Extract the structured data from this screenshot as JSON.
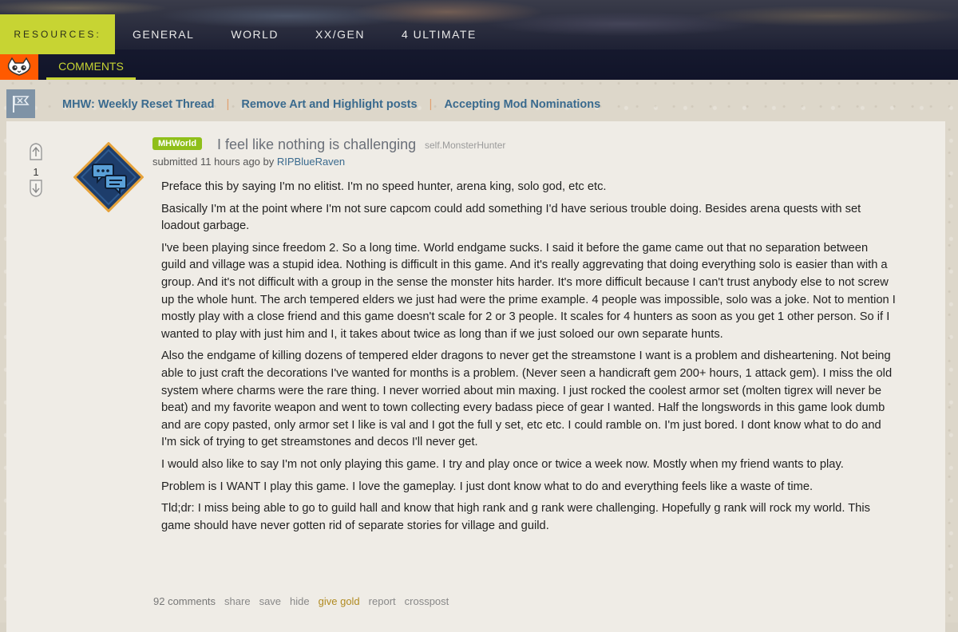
{
  "header": {
    "resources_label": "RESOURCES:",
    "nav": [
      "GENERAL",
      "WORLD",
      "XX/GEN",
      "4 ULTIMATE"
    ],
    "active_tab": "COMMENTS"
  },
  "sticky_links": [
    "MHW: Weekly Reset Thread",
    "Remove Art and Highlight posts",
    "Accepting Mod Nominations"
  ],
  "post": {
    "score": "1",
    "flair": "MHWorld",
    "title": "I feel like nothing is challenging",
    "domain": "self.MonsterHunter",
    "submitted_prefix": "submitted 11 hours ago by",
    "author": "RIPBlueRaven",
    "paragraphs": [
      "Preface this by saying I'm no elitist. I'm no speed hunter, arena king, solo god, etc etc.",
      "Basically I'm at the point where I'm not sure capcom could add something I'd have serious trouble doing. Besides arena quests with set loadout garbage.",
      "I've been playing since freedom 2. So a long time. World endgame sucks. I said it before the game came out that no separation between guild and village was a stupid idea. Nothing is difficult in this game. And it's really aggrevating that doing everything solo is easier than with a group. And it's not difficult with a group in the sense the monster hits harder. It's more difficult because I can't trust anybody else to not screw up the whole hunt. The arch tempered elders we just had were the prime example. 4 people was impossible, solo was a joke. Not to mention I mostly play with a close friend and this game doesn't scale for 2 or 3 people. It scales for 4 hunters as soon as you get 1 other person. So if I wanted to play with just him and I, it takes about twice as long than if we just soloed our own separate hunts.",
      "Also the endgame of killing dozens of tempered elder dragons to never get the streamstone I want is a problem and disheartening. Not being able to just craft the decorations I've wanted for months is a problem. (Never seen a handicraft gem 200+ hours, 1 attack gem). I miss the old system where charms were the rare thing. I never worried about min maxing. I just rocked the coolest armor set (molten tigrex will never be beat) and my favorite weapon and went to town collecting every badass piece of gear I wanted. Half the longswords in this game look dumb and are copy pasted, only armor set I like is val and I got the full y set, etc etc. I could ramble on. I'm just bored. I dont know what to do and I'm sick of trying to get streamstones and decos I'll never get.",
      "I would also like to say I'm not only playing this game. I try and play once or twice a week now. Mostly when my friend wants to play.",
      "Problem is I WANT I play this game. I love the gameplay. I just dont know what to do and everything feels like a waste of time.",
      "Tld;dr: I miss being able to go to guild hall and know that high rank and g rank were challenging. Hopefully g rank will rock my world. This game should have never gotten rid of separate stories for village and guild."
    ],
    "actions": {
      "comments": "92 comments",
      "share": "share",
      "save": "save",
      "hide": "hide",
      "give_gold": "give gold",
      "report": "report",
      "crosspost": "crosspost"
    }
  },
  "colors": {
    "accent": "#c7d433",
    "link": "#3a6a8e",
    "flair": "#8fbf1a",
    "cat_bg": "#ff5a00"
  }
}
